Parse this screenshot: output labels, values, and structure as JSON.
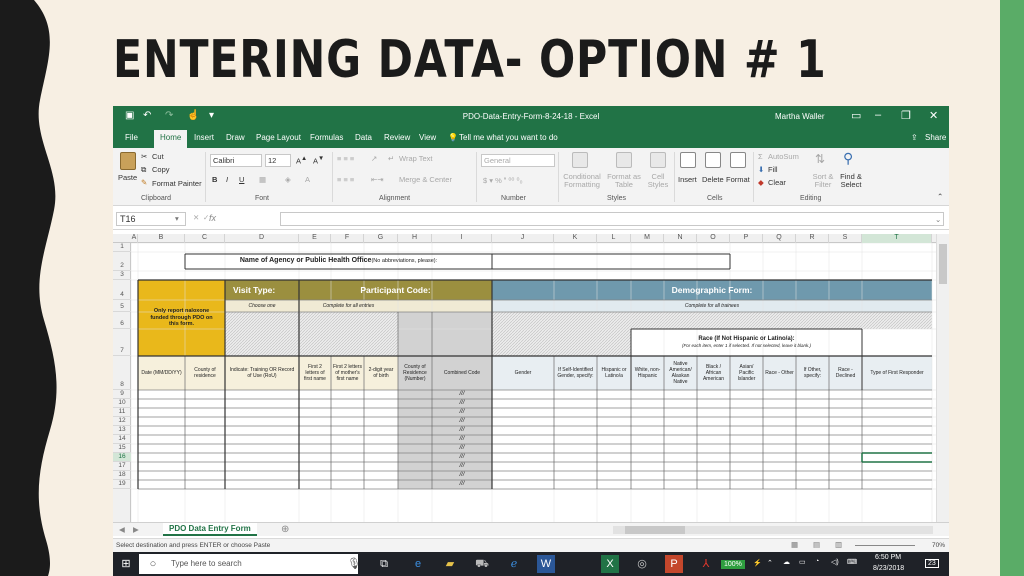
{
  "slide": {
    "title": "ENTERING DATA- OPTION # 1"
  },
  "excel": {
    "window_title": "PDO-Data-Entry-Form-8-24-18 - Excel",
    "user": "Martha Waller",
    "menu_tabs": [
      "File",
      "Home",
      "Insert",
      "Draw",
      "Page Layout",
      "Formulas",
      "Data",
      "Review",
      "View"
    ],
    "active_tab": "Home",
    "tell_me": "Tell me what you want to do",
    "share": "Share",
    "ribbon": {
      "paste": "Paste",
      "cut": "Cut",
      "copy": "Copy",
      "format_painter": "Format Painter",
      "font_name": "Calibri",
      "font_size": "12",
      "wrap_text": "Wrap Text",
      "merge_center": "Merge & Center",
      "number_format": "General",
      "conditional_formatting": "Conditional Formatting",
      "format_as_table": "Format as Table",
      "cell_styles": "Cell Styles",
      "insert": "Insert",
      "delete": "Delete",
      "format": "Format",
      "autosum": "AutoSum",
      "fill": "Fill",
      "clear": "Clear",
      "sort_filter": "Sort & Filter",
      "find_select": "Find & Select",
      "groups": [
        "Clipboard",
        "Font",
        "Alignment",
        "Number",
        "Styles",
        "Cells",
        "Editing"
      ]
    },
    "name_box": "T16",
    "formula_value": "",
    "columns": [
      "A",
      "B",
      "C",
      "D",
      "E",
      "F",
      "G",
      "H",
      "I",
      "J",
      "K",
      "L",
      "M",
      "N",
      "O",
      "P",
      "Q",
      "R",
      "S",
      "T"
    ],
    "selected_column": "T",
    "rows": [
      "1",
      "2",
      "3",
      "4",
      "5",
      "6",
      "7",
      "8",
      "9",
      "10",
      "11",
      "12",
      "13",
      "14",
      "15",
      "16",
      "17",
      "18",
      "19"
    ],
    "selected_row": "16",
    "sheet": {
      "agency_label": "Name of Agency or Public Health Office",
      "agency_note": "(No abbreviations, please):",
      "naloxone_note": "Only report naloxone funded through PDO on this form.",
      "visit_type": "Visit Type:",
      "choose_one": "Choose one",
      "participant_code": "Participant Code:",
      "complete_all_entries": "Complete for all entries",
      "demographic_form": "Demographic Form:",
      "complete_all_trainees": "Complete for all trainees",
      "race_title": "Race (If Not Hispanic or Latino/a):",
      "race_note": "(For each item, enter 1 if selected. If not selected, leave it blank.)",
      "headers": {
        "date": "Date (MM/DD/YY)",
        "county": "County of residence",
        "indicate": "Indicate: Training OR Record of Use (RoU)",
        "first2": "First 2 letters of first name",
        "mother2": "First 2 letters of mother's first name",
        "birth": "2-digit year of birth",
        "county_num": "County of Residence (Number)",
        "combined": "Combined Code",
        "gender": "Gender",
        "self_gender": "If Self-Identified Gender, specify:",
        "hispanic": "Hispanic or Latino/a",
        "white": "White, non-Hispanic",
        "native": "Native American/ Alaskan Native",
        "black": "Black / African American",
        "asian": "Asian/ Pacific Islander",
        "race_other": "Race - Other",
        "if_other": "If Other, specify:",
        "race_declined": "Race - Declined",
        "first_responder": "Type of First Responder"
      },
      "combined_placeholder": "///"
    },
    "sheet_tab": "PDO Data Entry Form",
    "status": "Select destination and press ENTER or choose Paste",
    "zoom": "70%"
  },
  "taskbar": {
    "search_placeholder": "Type here to search",
    "battery": "100%",
    "time": "6:50 PM",
    "date": "8/23/2018",
    "notifications": "23"
  },
  "colors": {
    "excel_green": "#217346",
    "slide_green": "#5aac67",
    "header_gold": "#e9b81b",
    "visit_olive": "#9b8f3f",
    "demo_blue": "#6f99ad"
  }
}
